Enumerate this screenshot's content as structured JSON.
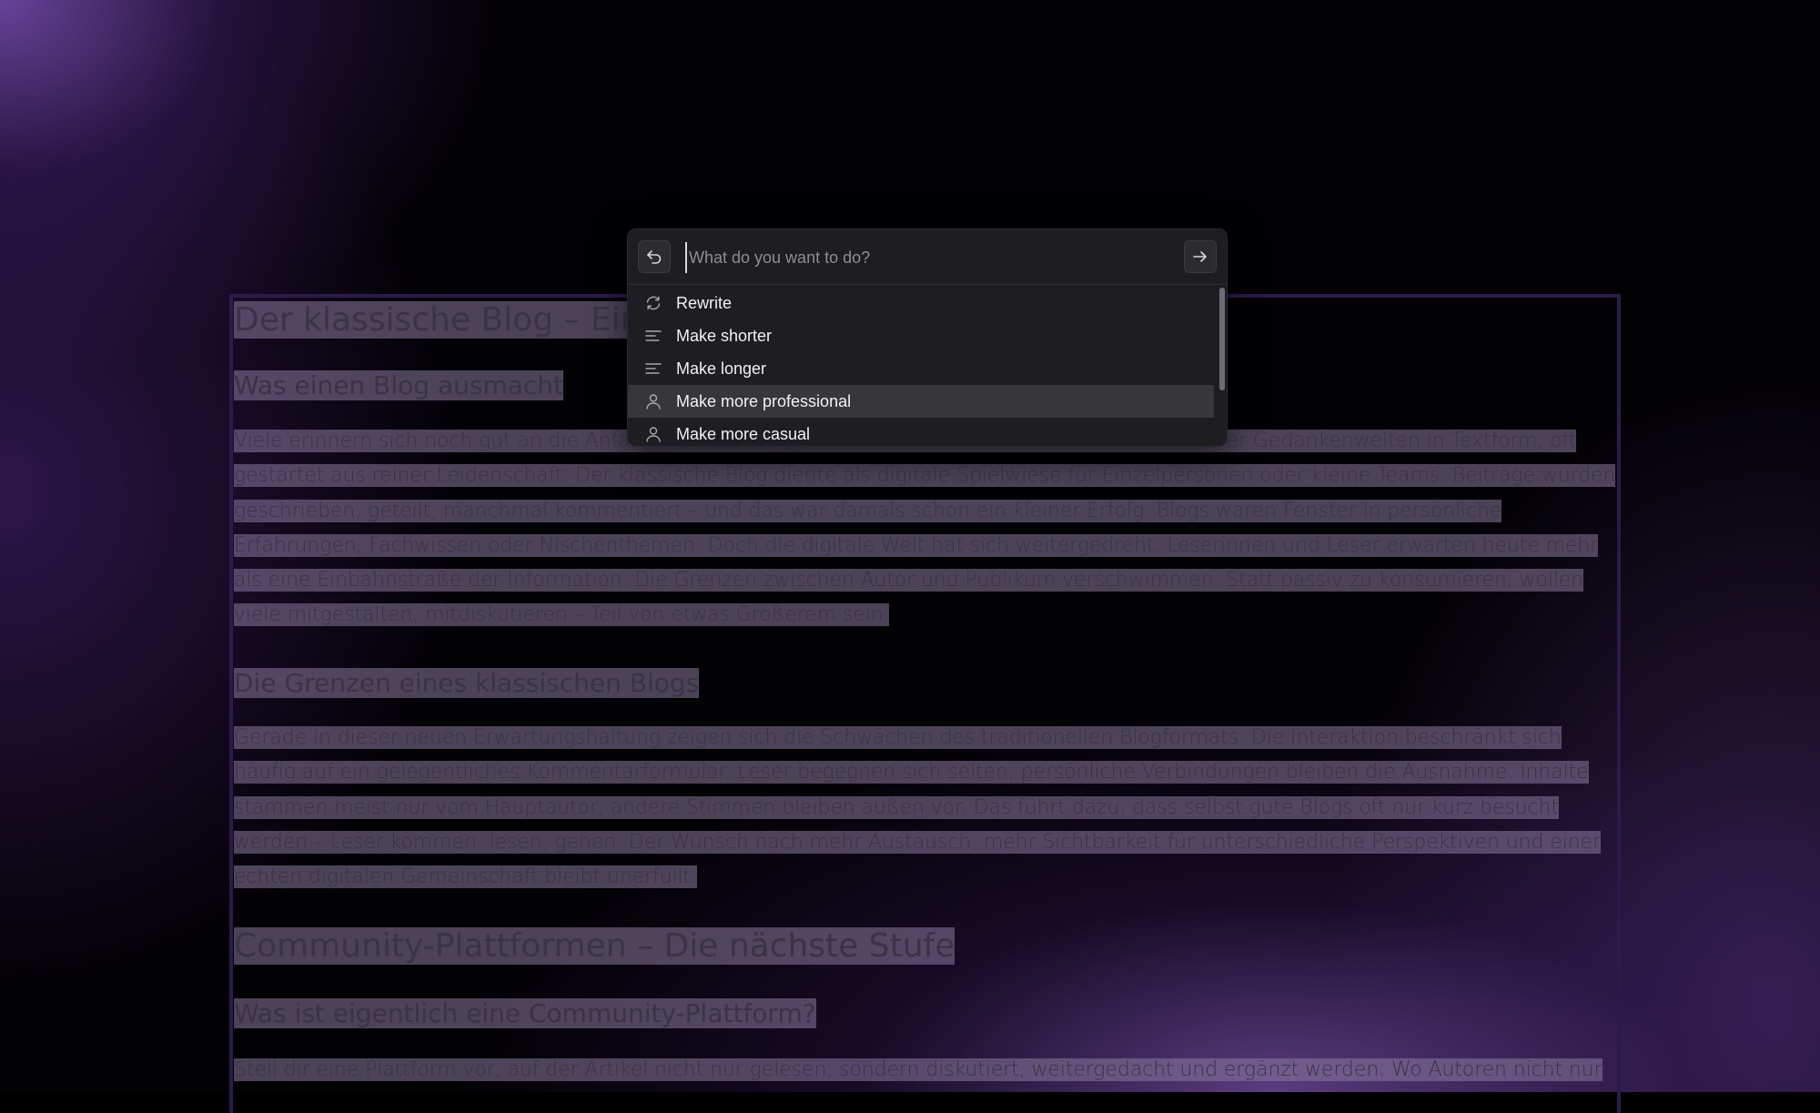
{
  "document": {
    "h1_title": "Der klassische Blog – Einst",
    "h2_blog": "Was einen Blog ausmacht",
    "p1": "Viele erinnern sich noch gut an die Anfangszeit des Bloggens. Es war die Ära der Persönlichkeiten, der Gedankenwelten in Textform, oft gestartet aus reiner Leidenschaft. Der klassische Blog diente als digitale Spielwiese für Einzelpersonen oder kleine Teams. Beiträge wurden geschrieben, geteilt, manchmal kommentiert – und das war damals schon ein kleiner Erfolg. Blogs waren Fenster in persönliche Erfahrungen, Fachwissen oder Nischenthemen. Doch die digitale Welt hat sich weitergedreht. Leserinnen und Leser erwarten heute mehr als eine Einbahnstraße der Information. Die Grenzen zwischen Autor und Publikum verschwimmen. Statt passiv zu konsumieren, wollen viele mitgestalten, mitdiskutieren – Teil von etwas Größerem sein.",
    "h2_grenzen": "Die Grenzen eines klassischen Blogs",
    "p2": "Gerade in dieser neuen Erwartungshaltung zeigen sich die Schwächen des traditionellen Blogformats. Die Interaktion beschränkt sich häufig auf ein gelegentliches Kommentarformular. Leser begegnen sich selten, persönliche Verbindungen bleiben die Ausnahme. Inhalte stammen meist nur vom Hauptautor, andere Stimmen bleiben außen vor. Das führt dazu, dass selbst gute Blogs oft nur kurz besucht werden – Leser kommen, lesen, gehen. Der Wunsch nach mehr Austausch, mehr Sichtbarkeit für unterschiedliche Perspektiven und einer echten digitalen Gemeinschaft bleibt unerfüllt.",
    "h1_community": "Community-Plattformen – Die nächste Stufe",
    "h2_community": "Was ist eigentlich eine Community-Plattform?",
    "p3": "Stell dir eine Plattform vor, auf der Artikel nicht nur gelesen, sondern diskutiert, weitergedacht und ergänzt werden. Wo Autoren nicht nur"
  },
  "palette": {
    "input_value": "",
    "input_placeholder": "What do you want to do?",
    "back_icon": "undo-arrow-icon",
    "submit_icon": "arrow-right-icon",
    "items": [
      {
        "label": "Rewrite",
        "icon": "refresh-icon",
        "active": false
      },
      {
        "label": "Make shorter",
        "icon": "lines-short-icon",
        "active": false
      },
      {
        "label": "Make longer",
        "icon": "lines-long-icon",
        "active": false
      },
      {
        "label": "Make more professional",
        "icon": "person-icon",
        "active": true
      },
      {
        "label": "Make more casual",
        "icon": "person-icon",
        "active": false
      }
    ]
  },
  "colors": {
    "highlight": "#8a7a9e",
    "palette_bg": "#1e1d21",
    "active_item_bg": "#37363b",
    "frame_border": "#2b1a4c"
  }
}
